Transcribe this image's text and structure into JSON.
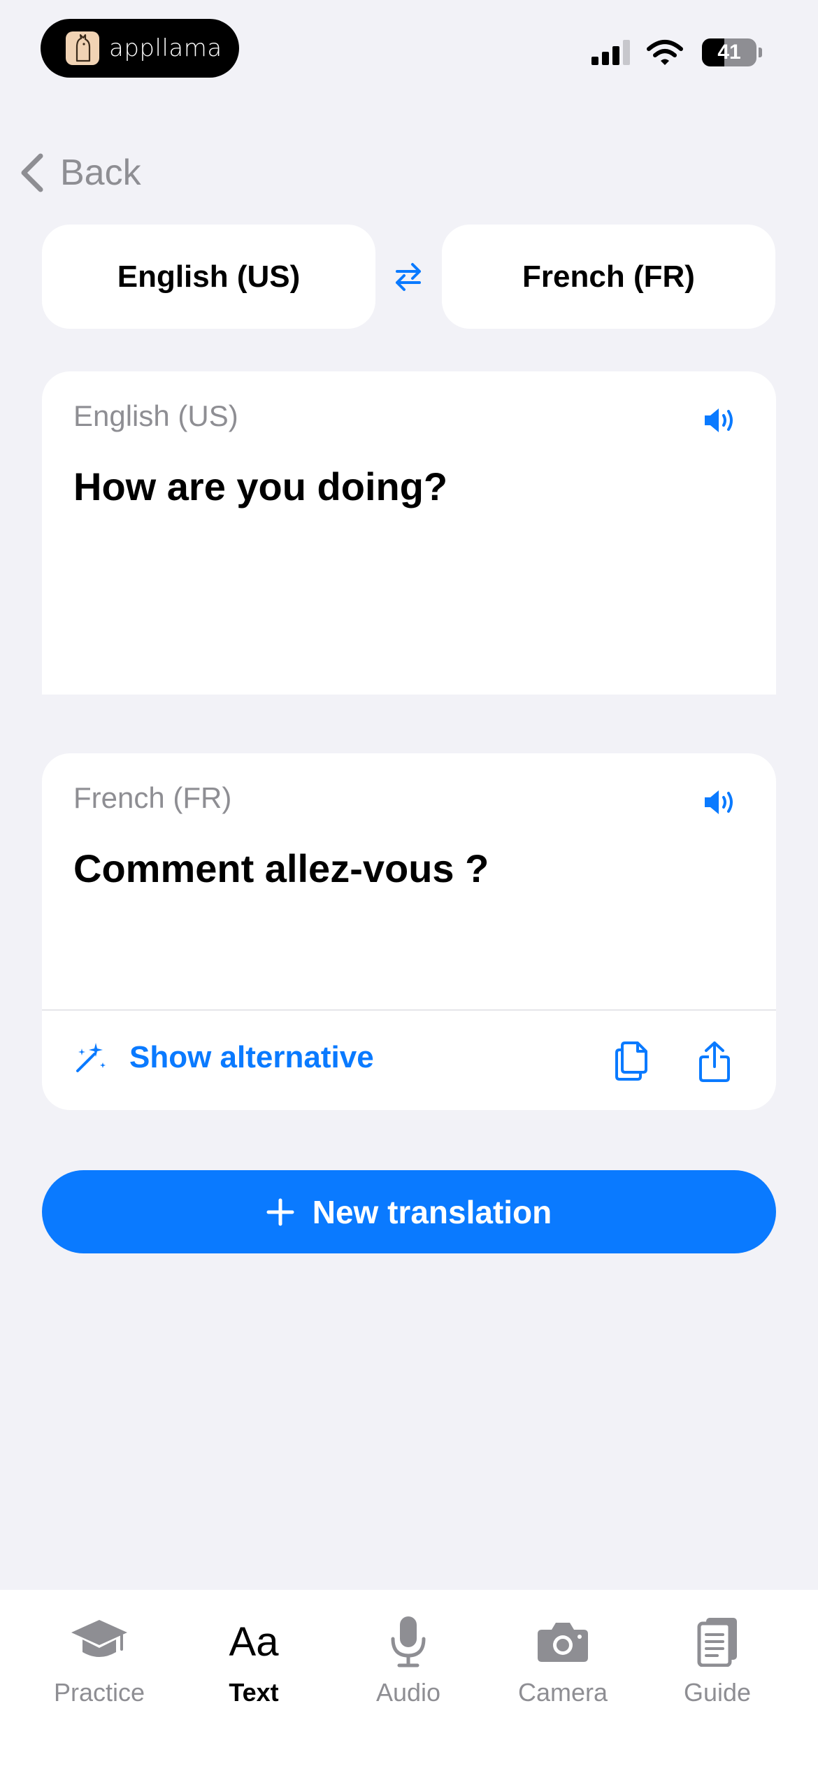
{
  "status": {
    "app_name": "appllama",
    "battery_percent": 41
  },
  "nav": {
    "back_label": "Back"
  },
  "languages": {
    "source": "English (US)",
    "target": "French (FR)"
  },
  "source_card": {
    "language": "English (US)",
    "text": "How are you doing?"
  },
  "target_card": {
    "language": "French (FR)",
    "text": "Comment allez-vous ?",
    "show_alternative_label": "Show alternative"
  },
  "actions": {
    "new_translation_label": "New translation"
  },
  "tabs": [
    {
      "label": "Practice",
      "icon": "graduation-cap-icon",
      "active": false
    },
    {
      "label": "Text",
      "icon": "text-aa-icon",
      "glyph": "Aa",
      "active": true
    },
    {
      "label": "Audio",
      "icon": "microphone-icon",
      "active": false
    },
    {
      "label": "Camera",
      "icon": "camera-icon",
      "active": false
    },
    {
      "label": "Guide",
      "icon": "book-icon",
      "active": false
    }
  ],
  "colors": {
    "accent": "#0A7AFF",
    "background": "#F2F2F7",
    "secondary_text": "#8E8E93",
    "tab_inactive": "#8E8E93"
  }
}
